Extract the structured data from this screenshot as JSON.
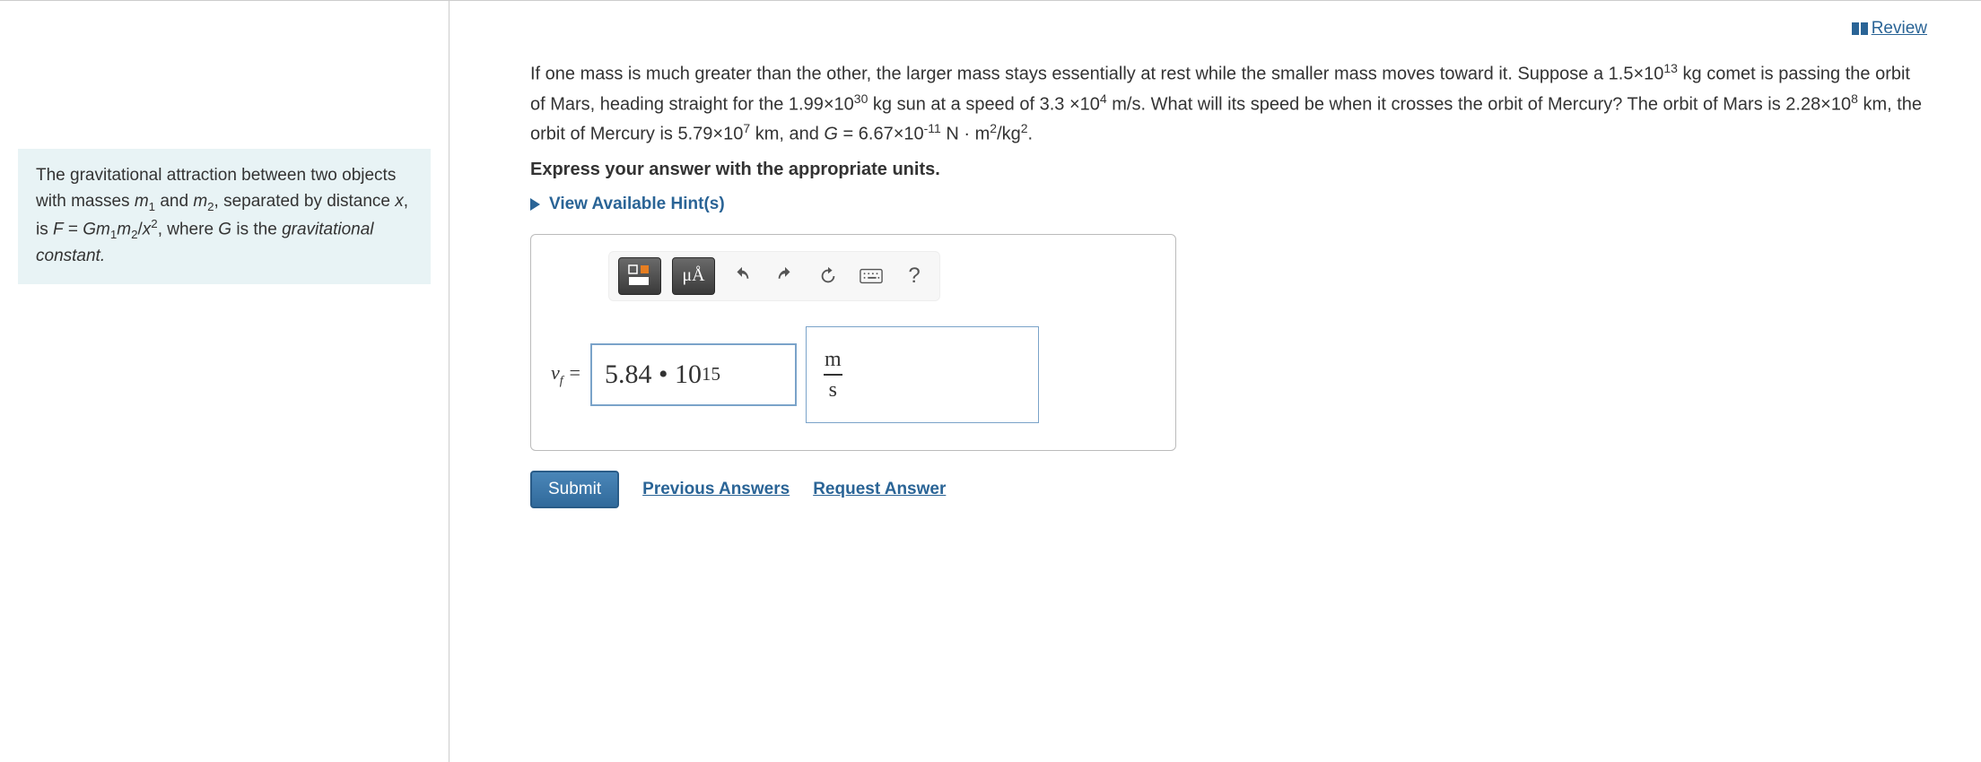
{
  "review_label": "Review",
  "info_box_html": "The gravitational attraction between two objects with masses <i>m</i><sub>1</sub> and <i>m</i><sub>2</sub>, separated by distance <i>x</i>, is <i>F</i> = <i>Gm</i><sub>1</sub><i>m</i><sub>2</sub>/<i>x</i><sup>2</sup>, where <i>G</i> is the <i>gravitational constant.</i>",
  "problem_html": "If one mass is much greater than the other, the larger mass stays essentially at rest while the smaller mass moves toward it. Suppose a 1.5×10<sup>13</sup> kg comet is passing the orbit of Mars, heading straight for the 1.99×10<sup>30</sup> kg sun at a speed of 3.3 ×10<sup>4</sup> m/s. What will its speed be when it crosses the orbit of Mercury? The orbit of Mars is 2.28×10<sup>8</sup> km, the orbit of Mercury is 5.79×10<sup>7</sup> km, and <i>G</i> = 6.67×10<sup>-11</sup> N · m<sup>2</sup>/kg<sup>2</sup>.",
  "express_text": "Express your answer with the appropriate units.",
  "hints_label": "View Available Hint(s)",
  "toolbar": {
    "templates_title": "Templates",
    "symbols_label": "μÅ",
    "undo_title": "Undo",
    "redo_title": "Redo",
    "reset_title": "Reset",
    "keyboard_title": "Keyboard",
    "help_label": "?"
  },
  "answer": {
    "var_html": "<i>v</i><sub>f</sub> = ",
    "value_html": "5.84 • 10<sup>15</sup>",
    "unit_num": "m",
    "unit_den": "s"
  },
  "buttons": {
    "submit": "Submit",
    "previous": "Previous Answers",
    "request": "Request Answer"
  }
}
